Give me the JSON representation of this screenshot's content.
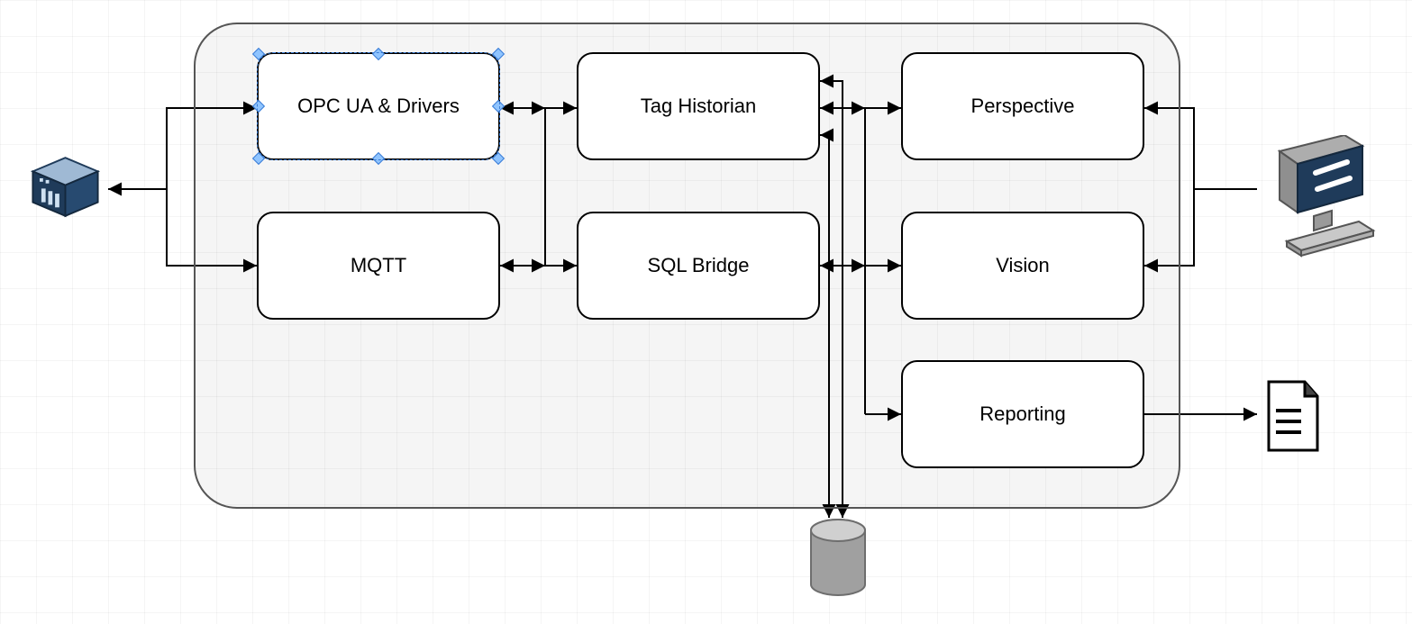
{
  "diagram": {
    "nodes": {
      "opc": {
        "label": "OPC UA & Drivers",
        "selected": true
      },
      "mqtt": {
        "label": "MQTT"
      },
      "historian": {
        "label": "Tag Historian"
      },
      "sqlbridge": {
        "label": "SQL Bridge"
      },
      "perspective": {
        "label": "Perspective"
      },
      "vision": {
        "label": "Vision"
      },
      "reporting": {
        "label": "Reporting"
      }
    },
    "icons": {
      "server": "server-icon",
      "database": "database-icon",
      "computer": "computer-icon",
      "document": "document-icon"
    }
  }
}
